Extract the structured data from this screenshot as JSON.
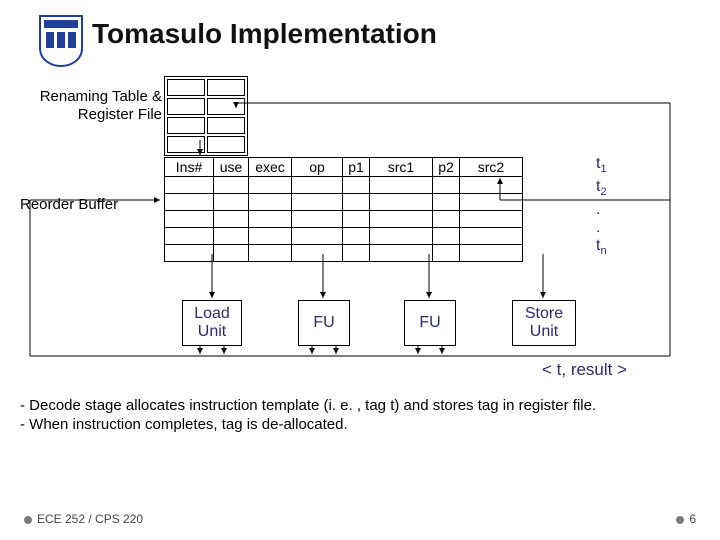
{
  "title": "Tomasulo Implementation",
  "labels": {
    "rename": "Renaming  Table & Register File",
    "reorder": "Reorder Buffer",
    "result": "< t, result >"
  },
  "rob_headers": {
    "ins": "Ins#",
    "use": "use",
    "exec": "exec",
    "op": "op",
    "p1": "p1",
    "src1": "src1",
    "p2": "p2",
    "src2": "src2"
  },
  "tlabels": {
    "t1": "t",
    "t1s": "1",
    "t2": "t",
    "t2s": "2",
    "dot": ".",
    "tn": "t",
    "tns": "n"
  },
  "units": {
    "load": "Load Unit",
    "fu": "FU",
    "store": "Store Unit"
  },
  "bullets": {
    "b1": "- Decode stage allocates instruction template (i. e. , tag t) and stores tag  in register file.",
    "b2": "- When instruction completes, tag is de-allocated."
  },
  "footer": {
    "left": "ECE 252 / CPS 220",
    "right": "6"
  },
  "chart_data": {
    "type": "diagram",
    "title": "Tomasulo Implementation",
    "components": [
      {
        "name": "Renaming Table & Register File"
      },
      {
        "name": "Reorder Buffer",
        "columns": [
          "Ins#",
          "use",
          "exec",
          "op",
          "p1",
          "src1",
          "p2",
          "src2"
        ],
        "rows_tagged": [
          "t1",
          "t2",
          "...",
          "tn"
        ]
      },
      {
        "name": "Load Unit"
      },
      {
        "name": "FU",
        "count": 2
      },
      {
        "name": "Store Unit"
      }
    ],
    "buses": [
      "< t, result >"
    ],
    "notes": [
      "Decode stage allocates instruction template (i.e., tag t) and stores tag in register file.",
      "When instruction completes, tag is de-allocated."
    ]
  }
}
